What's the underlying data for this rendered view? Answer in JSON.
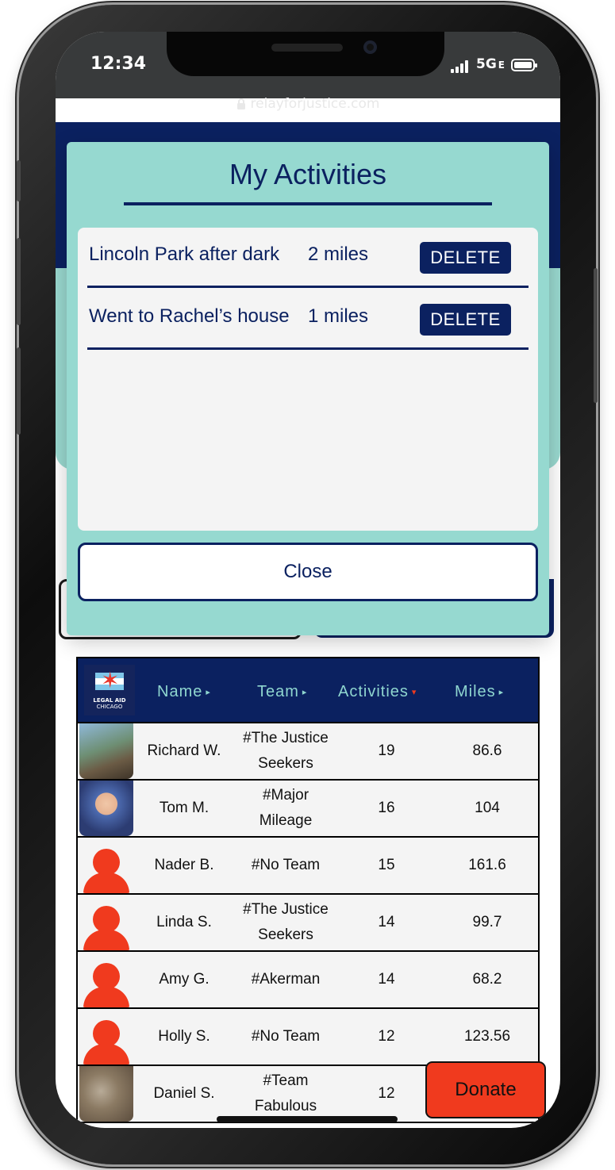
{
  "status_bar": {
    "time": "12:34",
    "network": "5G",
    "network_suffix": "E"
  },
  "browser": {
    "url": "relayforjustice.com"
  },
  "modal": {
    "title": "My Activities",
    "activities": [
      {
        "name": "Lincoln Park after dark",
        "miles": "2 miles",
        "delete_label": "DELETE"
      },
      {
        "name": "Went to Rachel’s house",
        "miles": "1 miles",
        "delete_label": "DELETE"
      }
    ],
    "close_label": "Close"
  },
  "leaderboard": {
    "logo_text": [
      "LEGAL AID",
      "CHICAGO"
    ],
    "columns": [
      {
        "label": "Name",
        "arrow": "▸",
        "arrow_color": "#8fd6cf"
      },
      {
        "label": "Team",
        "arrow": "▸",
        "arrow_color": "#8fd6cf"
      },
      {
        "label": "Activities",
        "arrow": "▾",
        "arrow_color": "#f03a1e"
      },
      {
        "label": "Miles",
        "arrow": "▸",
        "arrow_color": "#8fd6cf"
      }
    ],
    "rows": [
      {
        "avatar": "photo",
        "name": "Richard W.",
        "team": "#The Justice Seekers",
        "activities": "19",
        "miles": "86.6"
      },
      {
        "avatar": "photo",
        "name": "Tom M.",
        "team": "#Major Mileage",
        "activities": "16",
        "miles": "104"
      },
      {
        "avatar": "person-icon",
        "name": "Nader B.",
        "team": "#No Team",
        "activities": "15",
        "miles": "161.6"
      },
      {
        "avatar": "person-icon",
        "name": "Linda S.",
        "team": "#The Justice Seekers",
        "activities": "14",
        "miles": "99.7"
      },
      {
        "avatar": "person-icon",
        "name": "Amy G.",
        "team": "#Akerman",
        "activities": "14",
        "miles": "68.2"
      },
      {
        "avatar": "person-icon",
        "name": "Holly S.",
        "team": "#No Team",
        "activities": "12",
        "miles": "123.56"
      },
      {
        "avatar": "photo",
        "name": "Daniel S.",
        "team": "#Team Fabulous",
        "activities": "12",
        "miles": ""
      }
    ]
  },
  "donate_label": "Donate",
  "colors": {
    "navy": "#0b2160",
    "teal": "#96d9d0",
    "accent_red": "#f03a1e"
  }
}
